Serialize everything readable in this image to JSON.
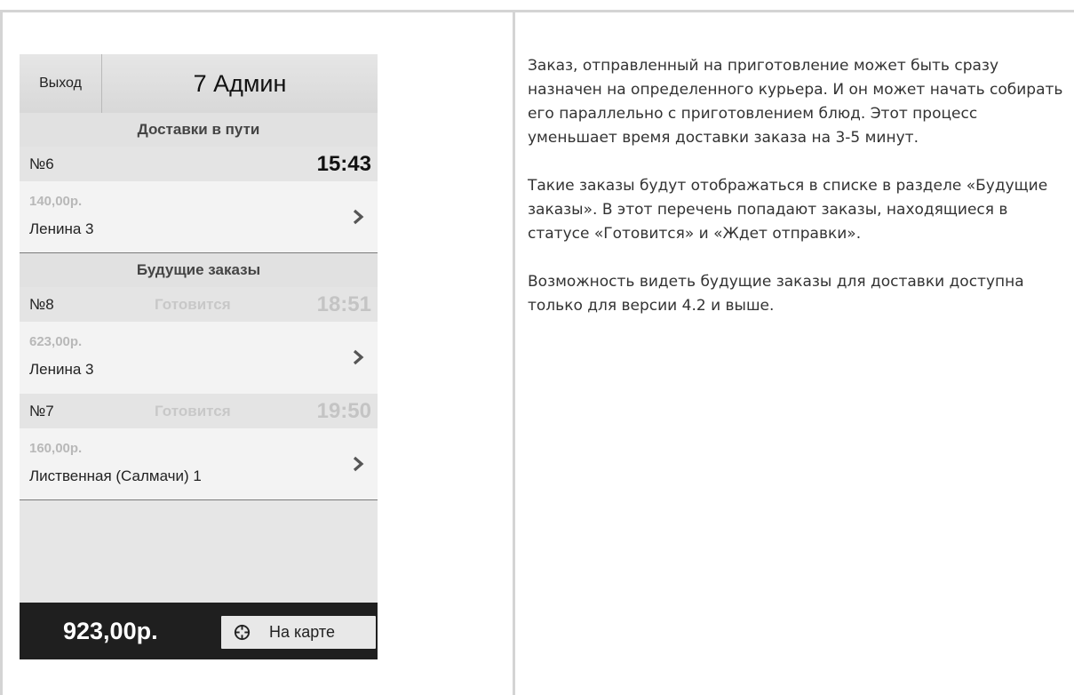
{
  "header": {
    "exit_label": "Выход",
    "title": "7 Админ"
  },
  "sections": {
    "in_transit": "Доставки в пути",
    "future": "Будущие заказы"
  },
  "orders": [
    {
      "number": "№6",
      "status": "",
      "time": "15:43",
      "price": "140,00р.",
      "address": "Ленина 3"
    },
    {
      "number": "№8",
      "status": "Готовится",
      "time": "18:51",
      "price": "623,00р.",
      "address": "Ленина 3"
    },
    {
      "number": "№7",
      "status": "Готовится",
      "time": "19:50",
      "price": "160,00р.",
      "address": "Лиственная (Салмачи) 1"
    }
  ],
  "footer": {
    "total": "923,00р.",
    "map_label": "На карте"
  },
  "description": {
    "p1": "Заказ, отправленный на приготовление может быть сразу назначен на определенного курьера. И он может начать собирать его параллельно с приготовлением блюд. Этот процесс уменьшает время доставки заказа на 3-5 минут.",
    "p2": "Такие заказы будут отображаться в списке в разделе «Будущие заказы». В этот перечень попадают заказы, находящиеся в статусе «Готовится» и «Ждет отправки».",
    "p3": "Возможность видеть будущие заказы для доставки доступна только для версии 4.2 и выше."
  },
  "icons": {
    "chevron": "chevron-right-icon",
    "map": "crosshair-icon"
  },
  "colors": {
    "bottom_bar": "#1f1f1f",
    "muted_text": "#c4c4c4",
    "frame": "#d4d4d4"
  }
}
